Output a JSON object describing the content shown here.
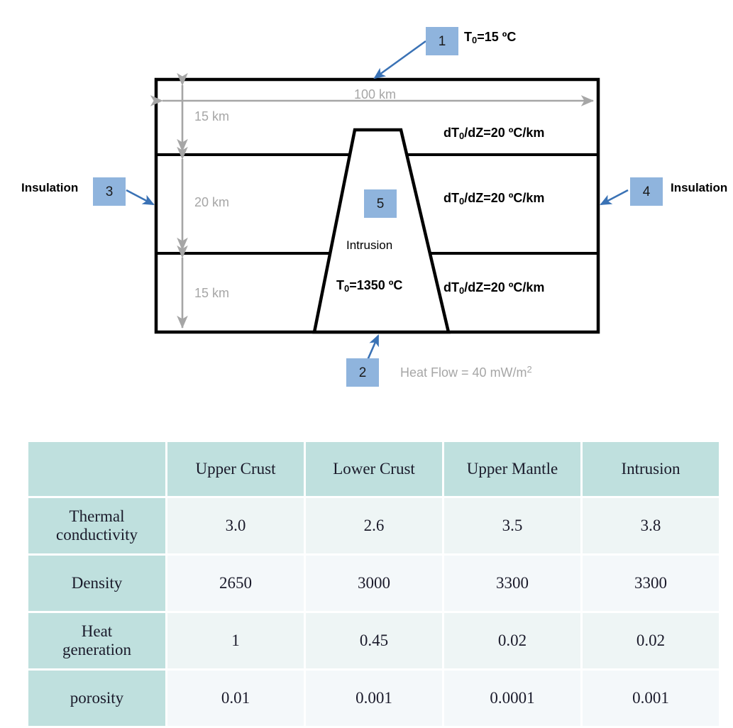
{
  "diagram": {
    "title_labels": {
      "top_boundary": "T<sub>0</sub>=15 ºC",
      "bottom_boundary": "Heat Flow = 40 mW/m<sup>2</sup>",
      "left_boundary": "Insulation",
      "right_boundary": "Insulation",
      "intrusion_name": "Intrusion",
      "intrusion_temp": "T<sub>0</sub>=1350 ºC"
    },
    "callouts": [
      {
        "id": "1",
        "label": "1"
      },
      {
        "id": "2",
        "label": "2"
      },
      {
        "id": "3",
        "label": "3"
      },
      {
        "id": "4",
        "label": "4"
      },
      {
        "id": "5",
        "label": "5"
      }
    ],
    "dimensions": {
      "width": "100 km",
      "layer1_thickness": "15 km",
      "layer2_thickness": "20 km",
      "layer3_thickness": "15 km"
    },
    "gradients": [
      "dT<sub>0</sub>/dZ=20 ºC/km",
      "dT<sub>0</sub>/dZ=20 ºC/km",
      "dT<sub>0</sub>/dZ=20 ºC/km"
    ],
    "colors": {
      "callout_fill": "#8fb4dd",
      "arrow_blue": "#3a72b5",
      "dimension_gray": "#a6a6a6",
      "outline_black": "#000000"
    }
  },
  "table": {
    "columns": [
      "",
      "Upper  Crust",
      "Lower  Crust",
      "Upper  Mantle",
      "Intrusion"
    ],
    "rows": [
      {
        "label": "Thermal\nconductivity",
        "label_line1": "Thermal",
        "label_line2": "conductivity",
        "values": [
          "3.0",
          "2.6",
          "3.5",
          "3.8"
        ]
      },
      {
        "label": "Density",
        "label_line1": "Density",
        "label_line2": "",
        "values": [
          "2650",
          "3000",
          "3300",
          "3300"
        ]
      },
      {
        "label": "Heat\ngeneration",
        "label_line1": "Heat",
        "label_line2": "generation",
        "values": [
          "1",
          "0.45",
          "0.02",
          "0.02"
        ]
      },
      {
        "label": "porosity",
        "label_line1": "porosity",
        "label_line2": "",
        "values": [
          "0.01",
          "0.001",
          "0.0001",
          "0.001"
        ]
      }
    ],
    "colors": {
      "header_fill": "#bfe0de",
      "rowlabel_fill": "#bfe0de",
      "cell_fill_odd": "#eef5f5",
      "cell_fill_even": "#f4f8fa"
    }
  }
}
